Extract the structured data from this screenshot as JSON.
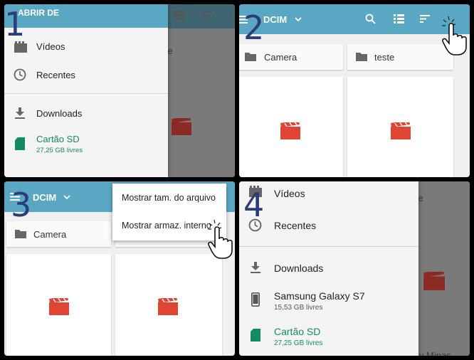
{
  "steps": [
    "1",
    "2",
    "3",
    "4"
  ],
  "panel1": {
    "drawer_title": "ABRIR DE",
    "items": [
      {
        "label": "Vídeos",
        "icon": "video-icon"
      },
      {
        "label": "Recentes",
        "icon": "clock-icon"
      },
      {
        "label": "Downloads",
        "icon": "download-icon"
      },
      {
        "label": "Cartão SD",
        "sub": "27,25 GB livres",
        "icon": "sd-card-icon"
      }
    ],
    "behind_text": "te"
  },
  "panel2": {
    "title": "DCIM",
    "folders": [
      "Camera",
      "teste"
    ]
  },
  "panel3": {
    "title": "DCIM",
    "folders": [
      "Camera"
    ],
    "menu": [
      "Mostrar tam. do arquivo",
      "Mostrar armaz. interno"
    ]
  },
  "panel4": {
    "items": [
      {
        "label": "Vídeos",
        "icon": "video-icon"
      },
      {
        "label": "Recentes",
        "icon": "clock-icon"
      },
      {
        "label": "Downloads",
        "icon": "download-icon"
      },
      {
        "label": "Samsung Galaxy S7",
        "sub": "15,53 GB livres",
        "icon": "phone-icon"
      },
      {
        "label": "Cartão SD",
        "sub": "27,25 GB livres",
        "icon": "sd-card-icon"
      }
    ],
    "behind_text": "te",
    "behind_bottom": "ly Minas"
  },
  "colors": {
    "appbar": "#5aa7c3",
    "accent_green": "#138b62",
    "video_red": "#df4535",
    "step_number": "#2b3d78"
  }
}
